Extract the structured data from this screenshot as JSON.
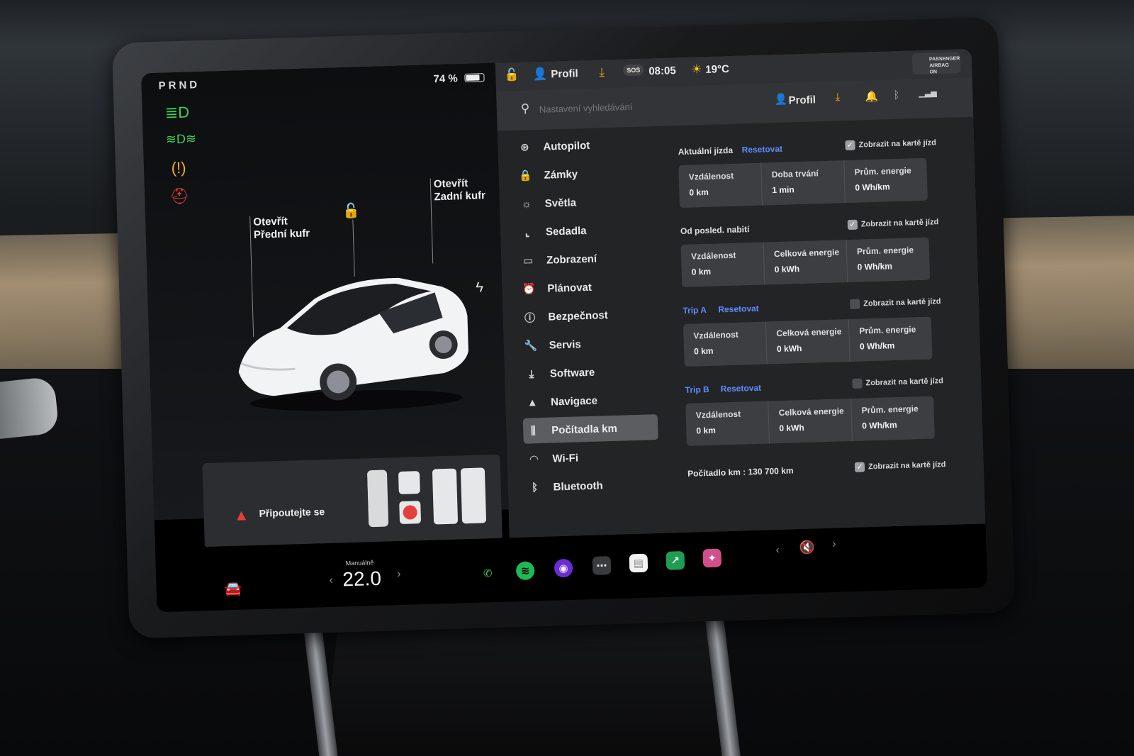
{
  "left_panel": {
    "gear": "PRND",
    "battery": "74 %",
    "battery_level": 0.74,
    "front_trunk": {
      "line1": "Otevřít",
      "line2": "Přední kufr"
    },
    "rear_trunk": {
      "line1": "Otevřít",
      "line2": "Zadní kufr"
    },
    "indicators": [
      "low-beam-icon",
      "fog-light-icon",
      "tire-pressure-icon",
      "seatbelt-icon"
    ],
    "indicator_colors": [
      "#3fcf5a",
      "#3fcf5a",
      "#f2b21a",
      "#e3403d"
    ],
    "seatbelt_warning": "Připoutejte se"
  },
  "bottom_bar": {
    "climate_mode": "Manuálně",
    "temperature": "22.0",
    "dock_icons": [
      "phone-icon",
      "spotify-icon",
      "camera-icon",
      "more-icon",
      "notes-icon",
      "stocks-icon",
      "arcade-icon"
    ]
  },
  "top_bar": {
    "profile": "Profil",
    "sos": "SOS",
    "time": "08:05",
    "weather": "19°C",
    "airbag_line1": "PASSENGER",
    "airbag_line2": "AIRBAG ON"
  },
  "search": {
    "placeholder": "Nastavení vyhledávání",
    "profile": "Profil"
  },
  "menu": [
    {
      "label": "Autopilot",
      "icon": "steering-wheel-icon"
    },
    {
      "label": "Zámky",
      "icon": "lock-icon"
    },
    {
      "label": "Světla",
      "icon": "light-icon"
    },
    {
      "label": "Sedadla",
      "icon": "seat-icon"
    },
    {
      "label": "Zobrazení",
      "icon": "display-icon"
    },
    {
      "label": "Plánovat",
      "icon": "alarm-clock-icon"
    },
    {
      "label": "Bezpečnost",
      "icon": "safety-icon"
    },
    {
      "label": "Servis",
      "icon": "wrench-icon"
    },
    {
      "label": "Software",
      "icon": "download-icon"
    },
    {
      "label": "Navigace",
      "icon": "navigation-icon"
    },
    {
      "label": "Počítadla km",
      "icon": "odometer-icon",
      "selected": true
    },
    {
      "label": "Wi-Fi",
      "icon": "wifi-icon"
    },
    {
      "label": "Bluetooth",
      "icon": "bluetooth-icon"
    }
  ],
  "trips": {
    "show_label": "Zobrazit na kartě jízd",
    "reset_label": "Resetovat",
    "current": {
      "title": "Aktuální jízda",
      "checked": true,
      "cells": [
        {
          "k": "Vzdálenost",
          "v": "0 km"
        },
        {
          "k": "Doba trvání",
          "v": "1 min"
        },
        {
          "k": "Prům. energie",
          "v": "0 Wh/km"
        }
      ]
    },
    "since_charge": {
      "title": "Od posled. nabití",
      "checked": true,
      "cells": [
        {
          "k": "Vzdálenost",
          "v": "0 km"
        },
        {
          "k": "Celková energie",
          "v": "0 kWh"
        },
        {
          "k": "Prům. energie",
          "v": "0 Wh/km"
        }
      ]
    },
    "trip_a": {
      "title": "Trip A",
      "checked": false,
      "cells": [
        {
          "k": "Vzdálenost",
          "v": "0 km"
        },
        {
          "k": "Celková energie",
          "v": "0 kWh"
        },
        {
          "k": "Prům. energie",
          "v": "0 Wh/km"
        }
      ]
    },
    "trip_b": {
      "title": "Trip B",
      "checked": false,
      "cells": [
        {
          "k": "Vzdálenost",
          "v": "0 km"
        },
        {
          "k": "Celková energie",
          "v": "0 kWh"
        },
        {
          "k": "Prům. energie",
          "v": "0 Wh/km"
        }
      ]
    },
    "odometer": "Počítadlo km : 130 700 km",
    "odometer_checked": true
  }
}
